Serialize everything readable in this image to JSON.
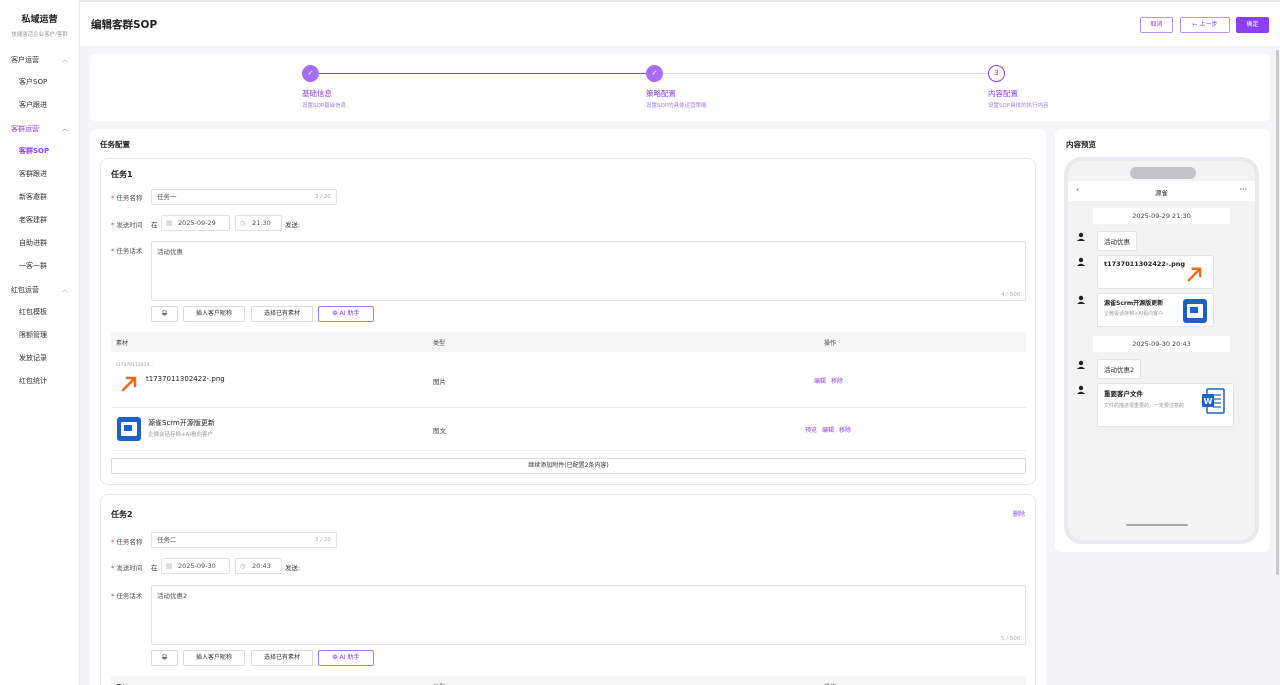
{
  "sidebar": {
    "brand": "私域运营",
    "brand_sub": "快捷激活企业客户/客群",
    "groups": [
      {
        "label": "客户运营",
        "items": [
          "客户SOP",
          "客户跟进"
        ]
      },
      {
        "label": "客群运营",
        "items": [
          "客群SOP",
          "客群跟进",
          "新客邀群",
          "老客建群",
          "自助进群",
          "一客一群"
        ]
      },
      {
        "label": "红包运营",
        "items": [
          "红包模板",
          "限额管理",
          "发放记录",
          "红包统计"
        ]
      }
    ]
  },
  "header": {
    "title": "编辑客群SOP",
    "cancel": "取消",
    "prev": "← 上一步",
    "confirm": "确定"
  },
  "steps": [
    {
      "title": "基础信息",
      "desc": "设置SOP基础信息",
      "state": "done"
    },
    {
      "title": "策略配置",
      "desc": "设置SOP的具体运营策略",
      "state": "done"
    },
    {
      "title": "内容配置",
      "desc": "设置SOP具体的执行内容",
      "state": "current",
      "num": "3"
    }
  ],
  "main": {
    "title": "任务配置",
    "labels": {
      "name": "任务名称",
      "time": "发送时间",
      "script": "任务话术",
      "at": "在",
      "send": "发送:",
      "col_material": "素材",
      "col_type": "类型",
      "col_action": "操作",
      "emoji": "😀",
      "insert_nick": "插入客户昵称",
      "choose_material": "选择已有素材",
      "ai": "AI 助手",
      "delete": "删除"
    },
    "task1": {
      "title": "任务1",
      "name": "任务一",
      "name_count": "3 / 20",
      "date": "2025-09-29",
      "time": "21:30",
      "script": "活动优惠",
      "script_count": "4 / 500",
      "rows": [
        {
          "tiny": "t17370113024...",
          "name": "t1737011302422-.png",
          "type": "图片",
          "actions": [
            "编辑",
            "移除"
          ]
        },
        {
          "name": "源雀Scrm开源版更新",
          "desc": "企微会话存档+AI看向客户",
          "type": "图文",
          "actions": [
            "预览",
            "编辑",
            "移除"
          ]
        }
      ],
      "add_more": "继续添加附件(已配置2条内容)"
    },
    "task2": {
      "title": "任务2",
      "name": "任务二",
      "name_count": "3 / 20",
      "date": "2025-09-30",
      "time": "20:43",
      "script": "活动优惠2",
      "script_count": "5 / 500"
    }
  },
  "preview": {
    "title": "内容预览",
    "phone_name": "源雀",
    "ts1": "2025-09-29 21:30",
    "msg1": "活动优惠",
    "img_name": "t1737011302422-.png",
    "card1_title": "源雀Scrm开源版更新",
    "card1_desc": "企微会话存档+AI看向客户",
    "ts2": "2025-09-30 20:43",
    "msg2": "活动优惠2",
    "card2_title": "重要客户文件",
    "card2_desc": "文件的描述很重要的，一定要注意的"
  },
  "colors": {
    "accent": "#8b3ff0",
    "arrow": "#f26b1d",
    "doc_blue": "#1f5fc8"
  }
}
